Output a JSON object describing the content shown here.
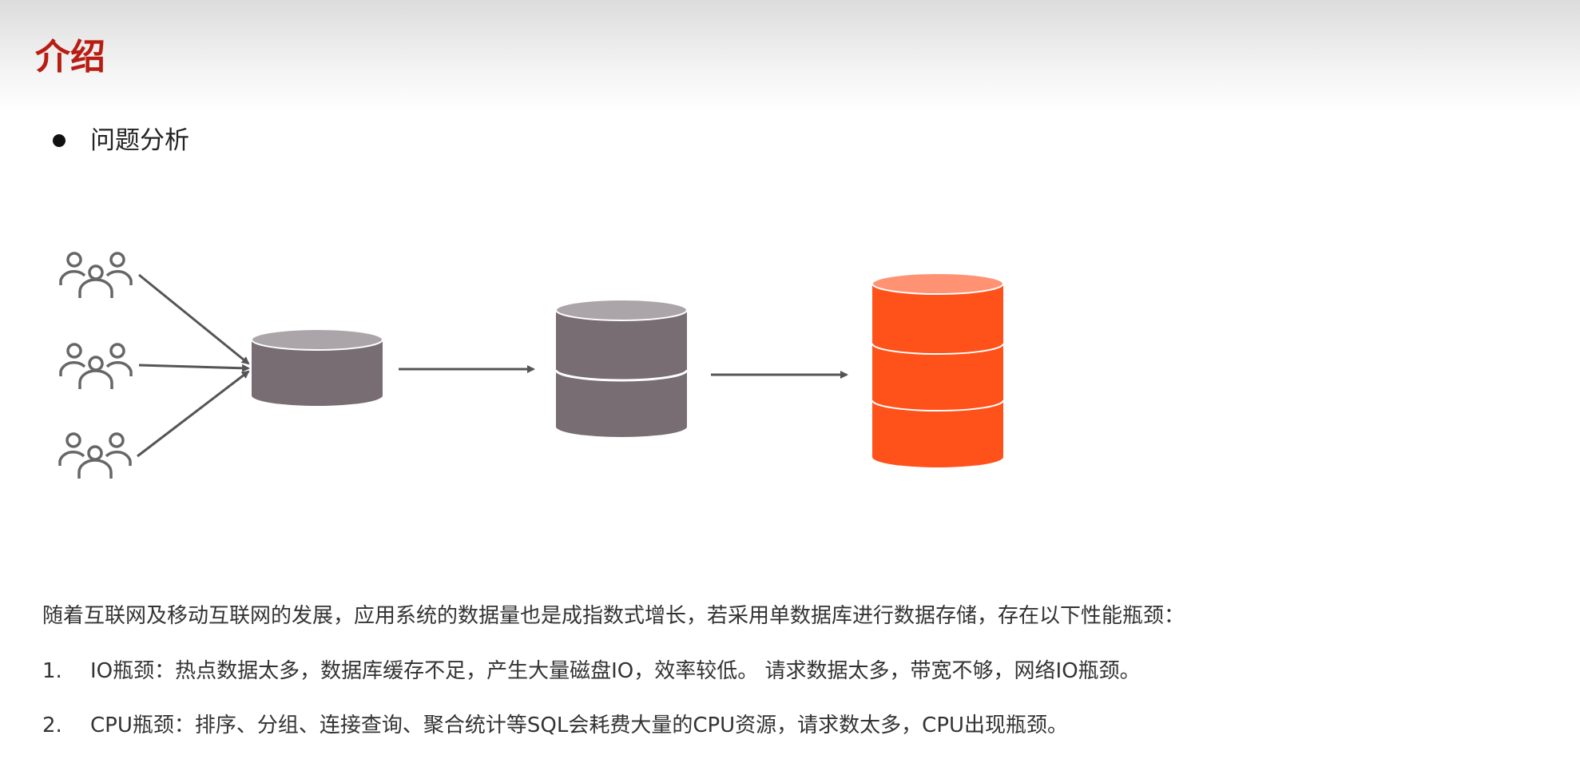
{
  "header": {
    "title": "介绍"
  },
  "section": {
    "bullet_label": "问题分析"
  },
  "diagram": {
    "icons": [
      "users-icon",
      "users-icon",
      "users-icon",
      "database-icon",
      "database-icon",
      "database-icon"
    ],
    "colors": {
      "gray_db": "#776d73",
      "gray_db_top": "#aba5a9",
      "orange_db": "#ff521b",
      "orange_db_top": "#ff9273",
      "arrow": "#555555"
    }
  },
  "body": {
    "intro": "随着互联网及移动互联网的发展，应用系统的数据量也是成指数式增长，若采用单数据库进行数据存储，存在以下性能瓶颈：",
    "items": [
      {
        "number": "1.",
        "text": "IO瓶颈：热点数据太多，数据库缓存不足，产生大量磁盘IO，效率较低。 请求数据太多，带宽不够，网络IO瓶颈。"
      },
      {
        "number": "2.",
        "text": "CPU瓶颈：排序、分组、连接查询、聚合统计等SQL会耗费大量的CPU资源，请求数太多，CPU出现瓶颈。"
      }
    ]
  }
}
